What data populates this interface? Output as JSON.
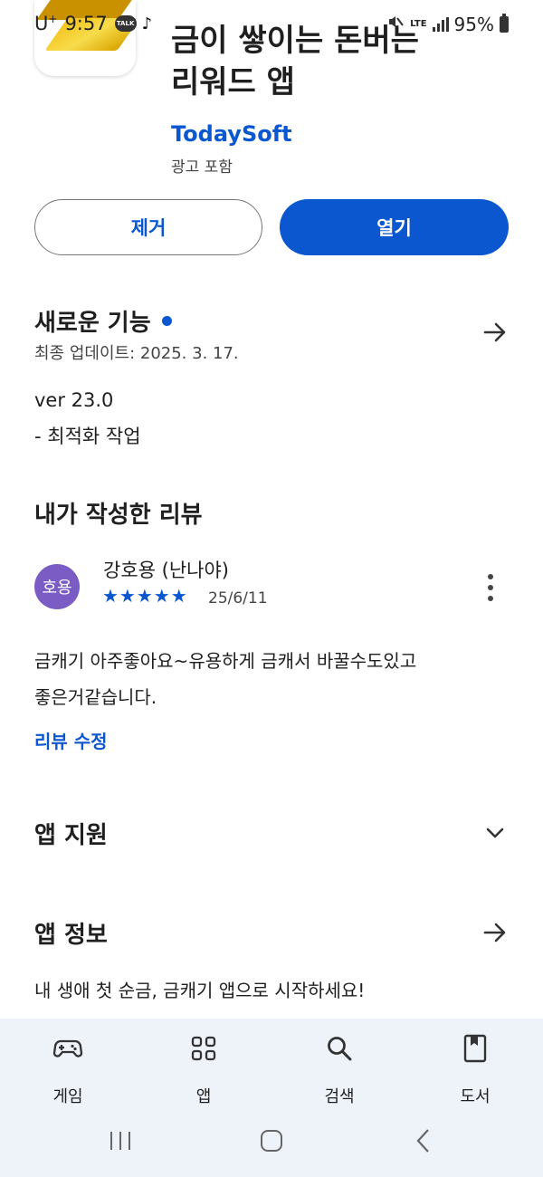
{
  "status_bar": {
    "carrier": "U",
    "carrier_sup": "+",
    "time": "9:57",
    "talk_badge": "TALK",
    "network": "LTE",
    "battery": "95%"
  },
  "app": {
    "title_line1": "금이 쌓이는 돈버는",
    "title_line2": "리워드 앱",
    "developer": "TodaySoft",
    "ad_label": "광고 포함"
  },
  "actions": {
    "remove_label": "제거",
    "open_label": "열기"
  },
  "whats_new": {
    "title": "새로운 기능",
    "updated": "최종 업데이트: 2025. 3. 17.",
    "version": "ver 23.0",
    "notes": "- 최적화 작업"
  },
  "my_review": {
    "section_title": "내가 작성한 리뷰",
    "avatar_text": "호용",
    "reviewer": "강호용 (난나야)",
    "rating": 5,
    "stars": "★★★★★",
    "date": "25/6/11",
    "text_line1": "금캐기 아주좋아요~유용하게 금캐서 바꿀수도있고",
    "text_line2": "좋은거같습니다.",
    "edit_label": "리뷰 수정"
  },
  "app_support": {
    "title": "앱 지원"
  },
  "app_info": {
    "title": "앱 정보",
    "description": "내 생애 첫 순금, 금캐기 앱으로 시작하세요!"
  },
  "bottom_nav": {
    "items": [
      {
        "label": "게임",
        "icon": "gamepad-icon"
      },
      {
        "label": "앱",
        "icon": "apps-grid-icon"
      },
      {
        "label": "검색",
        "icon": "search-icon"
      },
      {
        "label": "도서",
        "icon": "book-icon"
      }
    ]
  },
  "colors": {
    "accent": "#0b57d0",
    "avatar_bg": "#7b5bc4",
    "nav_bg": "#eef2f9"
  }
}
